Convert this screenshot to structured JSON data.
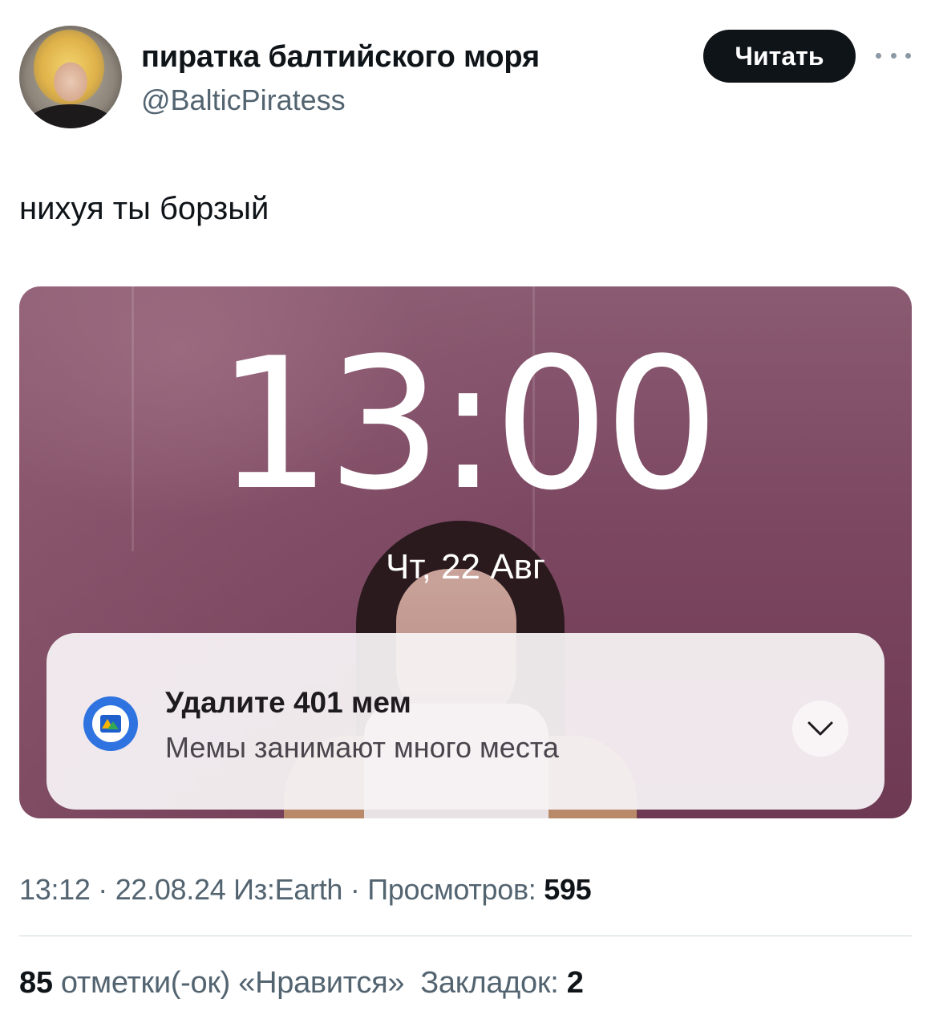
{
  "author": {
    "name": "пиратка балтийского моря",
    "handle": "@BalticPiratess",
    "follow_label": "Читать"
  },
  "tweet": {
    "text": "нихуя ты борзый"
  },
  "media": {
    "clock_time": "13:00",
    "date": "Чт, 22 Авг",
    "notification": {
      "title": "Удалите 401 мем",
      "body": "Мемы занимают много места",
      "app_icon": "gallery-app-icon",
      "expand_icon": "chevron-down-icon"
    }
  },
  "meta": {
    "time": "13:12",
    "separator": " · ",
    "date": "22.08.24",
    "source": "Из:Earth",
    "views_label": "Просмотров: ",
    "views_count": "595"
  },
  "stats": {
    "likes_count": "85",
    "likes_label": " отметки(-ок) «Нравится»",
    "bookmarks_label": "Закладок: ",
    "bookmarks_count": "2"
  }
}
